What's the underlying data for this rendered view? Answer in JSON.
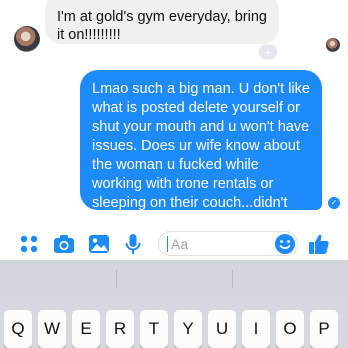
{
  "conversation": {
    "incoming_message": "I'm at gold's gym everyday, bring it on!!!!!!!!!",
    "reaction_badge": "+",
    "outgoing_message": "Lmao such a big man. U don't like what is posted delete yourself or shut your mouth and u won't have issues. Does ur wife know about the woman u fucked while working with trone rentals or sleeping on their couch...didn't think so",
    "sent_status_icon": "check-circle-icon"
  },
  "composer": {
    "placeholder": "Aa",
    "icons": [
      "apps-grid-icon",
      "camera-icon",
      "photo-gallery-icon",
      "microphone-icon",
      "emoji-icon",
      "thumbs-up-icon"
    ]
  },
  "keyboard": {
    "top_row": [
      "Q",
      "W",
      "E",
      "R",
      "T",
      "Y",
      "U",
      "I",
      "O",
      "P"
    ]
  },
  "colors": {
    "accent": "#1e8bfc",
    "incoming_bubble": "#f1f0f0",
    "keyboard_bg": "#d5d8de"
  }
}
